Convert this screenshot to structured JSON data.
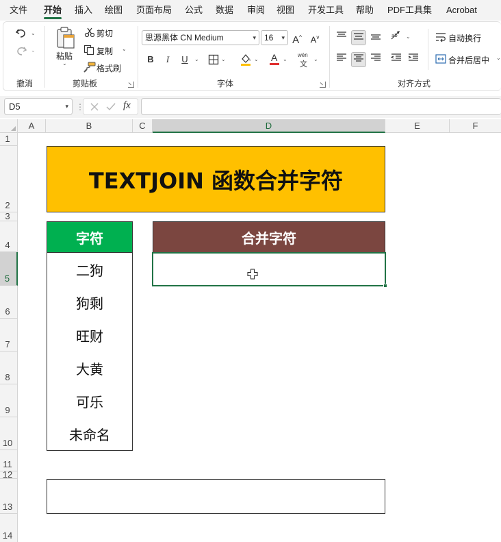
{
  "menu": {
    "tabs": [
      {
        "label": "文件"
      },
      {
        "label": "开始"
      },
      {
        "label": "插入"
      },
      {
        "label": "绘图"
      },
      {
        "label": "页面布局"
      },
      {
        "label": "公式"
      },
      {
        "label": "数据"
      },
      {
        "label": "审阅"
      },
      {
        "label": "视图"
      },
      {
        "label": "开发工具"
      },
      {
        "label": "帮助"
      },
      {
        "label": "PDF工具集"
      },
      {
        "label": "Acrobat"
      }
    ],
    "active_tab": "开始"
  },
  "ribbon": {
    "undo_group": {
      "label": "撤消"
    },
    "clipboard": {
      "label": "剪贴板",
      "paste": "粘贴",
      "cut": "剪切",
      "copy": "复制",
      "format_painter": "格式刷"
    },
    "font": {
      "label": "字体",
      "font_name": "思源黑体 CN Medium",
      "font_size": "16",
      "bold": "B",
      "italic": "I",
      "underline": "U",
      "font_color_letter": "A",
      "phonetic_top": "wén",
      "phonetic_bottom": "文"
    },
    "alignment": {
      "label": "对齐方式",
      "wrap_text": "自动换行",
      "merge_center": "合并后居中"
    }
  },
  "formula_bar": {
    "name_box": "D5",
    "fx_label": "fx",
    "formula": ""
  },
  "grid": {
    "columns": [
      "A",
      "B",
      "C",
      "D",
      "E",
      "F"
    ],
    "selected_column": "D",
    "rows": [
      "1",
      "2",
      "3",
      "4",
      "5",
      "6",
      "7",
      "8",
      "9",
      "10",
      "11",
      "12",
      "13",
      "14"
    ],
    "selected_row": "5"
  },
  "sheet": {
    "title": "TEXTJOIN 函数合并字符",
    "left_header": "字符",
    "right_header": "合并字符",
    "items": [
      "二狗",
      "狗剩",
      "旺财",
      "大黄",
      "可乐",
      "未命名"
    ],
    "active_cell_value": "",
    "bottom_box_value": ""
  },
  "colors": {
    "title_fill": "#ffc000",
    "left_header_fill": "#00b050",
    "right_header_fill": "#7b4640",
    "excel_accent": "#217346"
  }
}
